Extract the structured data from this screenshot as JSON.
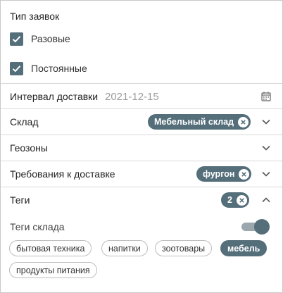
{
  "request_type": {
    "title": "Тип заявок",
    "options": [
      {
        "label": "Разовые",
        "checked": true
      },
      {
        "label": "Постоянные",
        "checked": true
      }
    ]
  },
  "delivery_interval": {
    "label": "Интервал доставки",
    "value": "2021-12-15",
    "icon": "calendar-icon"
  },
  "warehouse": {
    "label": "Склад",
    "chip": "Мебельный склад",
    "icon": "chevron-down-icon"
  },
  "geozones": {
    "label": "Геозоны",
    "icon": "chevron-down-icon"
  },
  "delivery_requirements": {
    "label": "Требования к доставке",
    "chip": "фургон",
    "icon": "chevron-down-icon"
  },
  "tags": {
    "label": "Теги",
    "count_chip": "2",
    "icon": "chevron-up-icon",
    "warehouse_tags_label": "Теги склада",
    "warehouse_tags_toggle_on": true,
    "items": [
      {
        "label": "бытовая техника",
        "selected": false
      },
      {
        "label": "напитки",
        "selected": false
      },
      {
        "label": "зоотовары",
        "selected": false
      },
      {
        "label": "мебель",
        "selected": true
      },
      {
        "label": "продукты питания",
        "selected": false
      }
    ]
  },
  "colors": {
    "accent": "#546e7a",
    "border": "#d9d9d9",
    "placeholder_text": "#9e9e9e"
  }
}
